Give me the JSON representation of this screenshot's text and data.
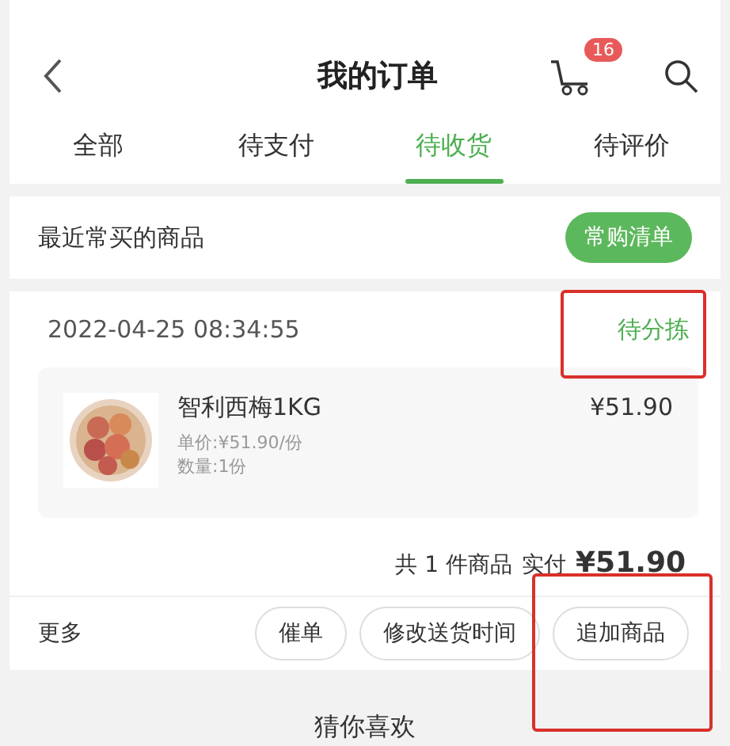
{
  "header": {
    "title": "我的订单",
    "cart_count": "16"
  },
  "tabs": [
    {
      "label": "全部",
      "selected": false
    },
    {
      "label": "待支付",
      "selected": false
    },
    {
      "label": "待收货",
      "selected": true
    },
    {
      "label": "待评价",
      "selected": false
    }
  ],
  "recent": {
    "label": "最近常买的商品",
    "button": "常购清单"
  },
  "order": {
    "time": "2022-04-25 08:34:55",
    "status": "待分拣",
    "item": {
      "name": "智利西梅1KG",
      "unit_price": "单价:¥51.90/份",
      "quantity": "数量:1份",
      "price": "¥51.90"
    },
    "summary": "共 1 件商品",
    "paid_label": "实付",
    "paid": "¥51.90",
    "more": "更多",
    "actions": [
      "催单",
      "修改送货时间",
      "追加商品"
    ]
  },
  "recommend": "猜你喜欢"
}
